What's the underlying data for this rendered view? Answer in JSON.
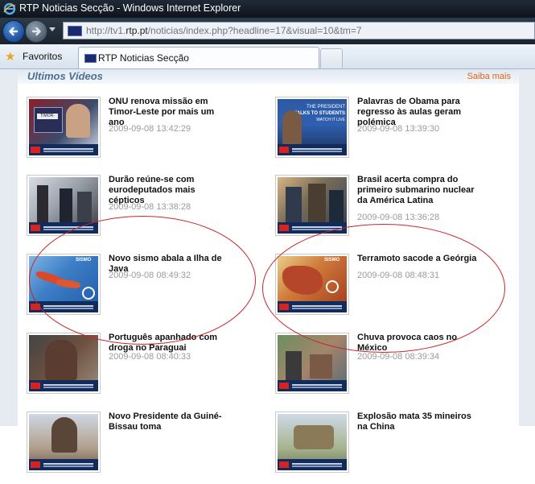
{
  "window": {
    "title": "RTP Noticias Secção - Windows Internet Explorer"
  },
  "address_bar": {
    "url_prefix": "http://tv1.",
    "url_domain": "rtp.pt",
    "url_suffix": "/noticias/index.php?headline=17&visual=10&tm=7"
  },
  "toolbar": {
    "favorites_label": "Favoritos",
    "tab_label": "RTP Noticias Secção"
  },
  "section": {
    "title": "Ultimos Vídeos",
    "see_more": "Saiba mais"
  },
  "videos": [
    {
      "headline": "ONU renova missão em Timor-Leste por mais um ano",
      "timestamp": "2009-09-08 13:42:29",
      "thumb": "timor-news-thumbnail",
      "circled": false
    },
    {
      "headline": "Palavras de Obama para regresso às aulas geram polémica",
      "timestamp": "2009-09-08 13:39:30",
      "thumb": "obama-talks-to-students-thumbnail",
      "circled": false
    },
    {
      "headline": "Durão reúne-se com eurodeputados mais cépticos",
      "timestamp": "2009-09-08 13:38:28",
      "thumb": "meeting-thumbnail",
      "circled": false
    },
    {
      "headline": "Brasil acerta compra do primeiro submarino nuclear da América Latina",
      "timestamp": "2009-09-08 13:36:28",
      "thumb": "submarine-thumbnail",
      "circled": false
    },
    {
      "headline": "Novo sismo abala a Ilha de Java",
      "timestamp": "2009-09-08 08:49:32",
      "thumb": "java-map-thumbnail",
      "circled": true
    },
    {
      "headline": "Terramoto sacode a Geórgia",
      "timestamp": "2009-09-08 08:48:31",
      "thumb": "georgia-map-thumbnail",
      "circled": true
    },
    {
      "headline": "Português apanhado com droga no Paraguai",
      "timestamp": "2009-09-08 08:40:33",
      "thumb": "drug-arrest-thumbnail",
      "circled": false
    },
    {
      "headline": "Chuva provoca caos no México",
      "timestamp": "2009-09-08 08:39:34",
      "thumb": "mexico-rain-thumbnail",
      "circled": false
    },
    {
      "headline": "Novo Presidente da Guiné-Bissau toma",
      "timestamp": "",
      "thumb": "president-thumbnail",
      "circled": false
    },
    {
      "headline": "Explosão mata 35 mineiros na China",
      "timestamp": "",
      "thumb": "mine-explosion-thumbnail",
      "circled": false
    }
  ],
  "thumb_captions": {
    "timor": "TIMOR-LESTE",
    "obama_line1": "THE PRESIDENT",
    "obama_line2": "TALKS TO STUDENTS",
    "obama_line3": "WATCH IT LIVE",
    "sismo": "SISMO"
  },
  "colors": {
    "annotation": "#c8262c",
    "section_title": "#4a6f95",
    "see_more": "#e0621c",
    "timestamp": "#9a9a9a"
  }
}
